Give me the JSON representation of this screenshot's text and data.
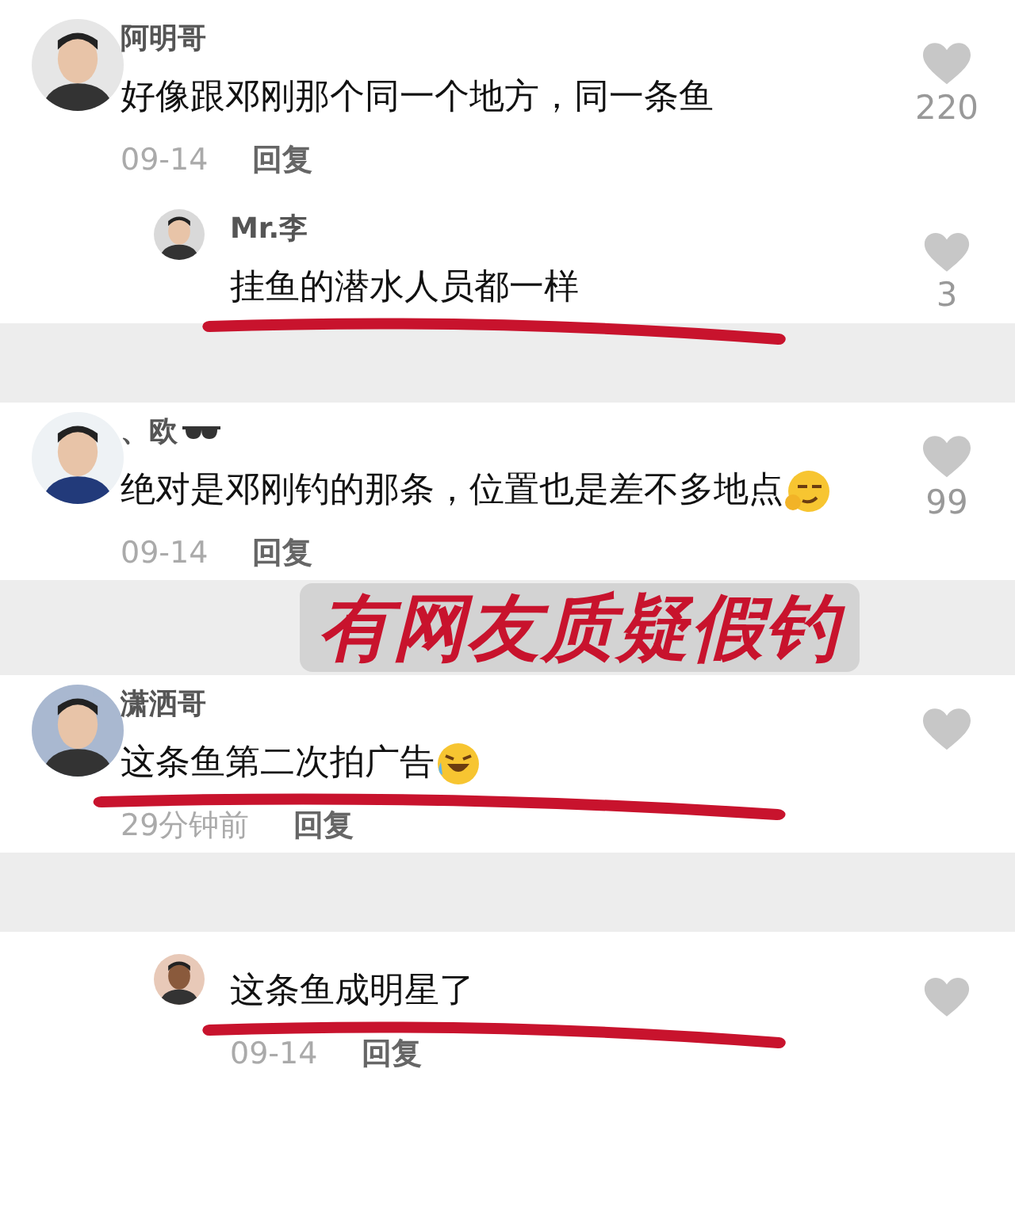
{
  "strips": [
    {
      "kind": "comments",
      "comments": [
        {
          "name": "阿明哥",
          "name_icon": false,
          "text": "好像跟邓刚那个同一个地方，同一条鱼",
          "time": "09-14",
          "reply_label": "回复",
          "likes": "220",
          "underlined": false,
          "reply_indent": false,
          "replies": [
            {
              "name": "Mr.李",
              "name_icon": false,
              "text": "挂鱼的潜水人员都一样",
              "likes": "3",
              "underlined": true,
              "reply_indent": true
            }
          ]
        }
      ]
    },
    {
      "kind": "comments",
      "comments": [
        {
          "name": "、欧",
          "name_icon": true,
          "kind": "smirk",
          "text": "绝对是邓刚钓的那条，位置也是差不多地点",
          "time": "09-14",
          "reply_label": "回复",
          "likes": "99",
          "underlined": false,
          "reply_indent": false
        }
      ]
    },
    {
      "kind": "banner",
      "text": "有网友质疑假钓"
    },
    {
      "kind": "comments",
      "comments": [
        {
          "name": "潇洒哥",
          "name_icon": false,
          "kind": "laugh",
          "text": "这条鱼第二次拍广告",
          "time": "29分钟前",
          "reply_label": "回复",
          "underlined": true,
          "reply_indent": false
        }
      ]
    },
    {
      "kind": "comments",
      "comments": [
        {
          "text": "这条鱼成明星了",
          "time": "09-14",
          "reply_label": "回复",
          "underlined": true,
          "reply_indent": true
        }
      ]
    }
  ]
}
